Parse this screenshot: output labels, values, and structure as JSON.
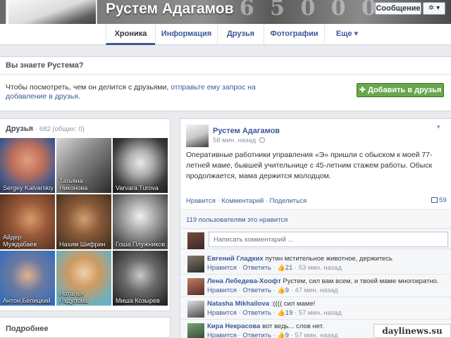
{
  "header": {
    "profile_name": "Рустем Адагамов",
    "follow_button": "Сообщение",
    "gear_button": "✲ ▾"
  },
  "nav": {
    "tabs": [
      "Хроника",
      "Информация",
      "Друзья",
      "Фотографии",
      "Еще ▾"
    ]
  },
  "know_box": {
    "title": "Вы знаете Рустема?",
    "text_prefix": "Чтобы посмотреть, чем он делится с друзьями, ",
    "text_link": "отправьте ему запрос на добавление в друзья",
    "text_suffix": ".",
    "add_button": "Добавить в друзья"
  },
  "friends": {
    "title": "Друзья",
    "count": "· 682 (общих: 0)",
    "items": [
      {
        "name": "Sergey Kalvarskiy"
      },
      {
        "name": "Татьяна Никонова"
      },
      {
        "name": "Varvara Turova"
      },
      {
        "name": "Айдер Муждабаев"
      },
      {
        "name": "Нахим Шифрин"
      },
      {
        "name": "Гоша Плужников"
      },
      {
        "name": "Антон Белицкий"
      },
      {
        "name": "Наталья Радулова"
      },
      {
        "name": "Миша Козырев"
      }
    ]
  },
  "more_section": {
    "title": "Подробнее"
  },
  "post": {
    "author": "Рустем Адагамов",
    "time": "58 мин. назад",
    "text": "Оперативные работники управления «Э» пришли с обыском к моей 77-летней маме, бывшей учительнице с 45-летним стажем работы. Обыск продолжается, мама держится молодцом.",
    "actions": [
      "Нравится",
      "Комментарий",
      "Поделиться"
    ],
    "comment_count": "59",
    "likes_text": "119 пользователям это нравится",
    "comment_placeholder": "Написать комментарий ...",
    "comments": [
      {
        "author": "Евгений Гладких",
        "text": "путин мстительное животное, держитесь",
        "likes": "21",
        "time": "53 мин. назад"
      },
      {
        "author": "Лена Лебедева-Хоофт",
        "text": "Рустем, сил вам всем, и твоей маме многократно.",
        "likes": "9",
        "time": "47 мин. назад"
      },
      {
        "author": "Natasha Mikhailova",
        "text": ":(((( сил маме!",
        "likes": "19",
        "time": "57 мин. назад"
      },
      {
        "author": "Кира Некрасова",
        "text": "вот ведь... слов нет.",
        "likes": "9",
        "time": "57 мин. назад"
      }
    ],
    "comment_actions": [
      "Нравится",
      "Ответить"
    ]
  },
  "watermark": "daylinews.su"
}
